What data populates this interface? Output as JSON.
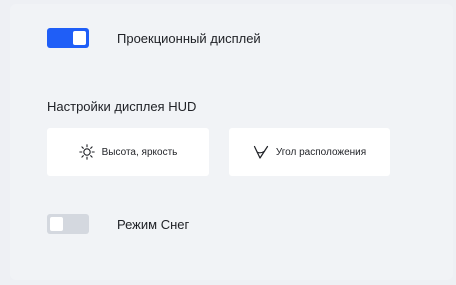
{
  "hud": {
    "label": "Проекционный дисплей",
    "toggle_state": "on",
    "accent": "#1f5ef7"
  },
  "settings": {
    "title": "Настройки дисплея HUD",
    "cards": [
      {
        "label": "Высота, яркость",
        "icon": "sun-brightness-icon"
      },
      {
        "label": "Угол расположения",
        "icon": "angle-icon"
      }
    ]
  },
  "snow_mode": {
    "label": "Режим Снег",
    "toggle_state": "off"
  }
}
